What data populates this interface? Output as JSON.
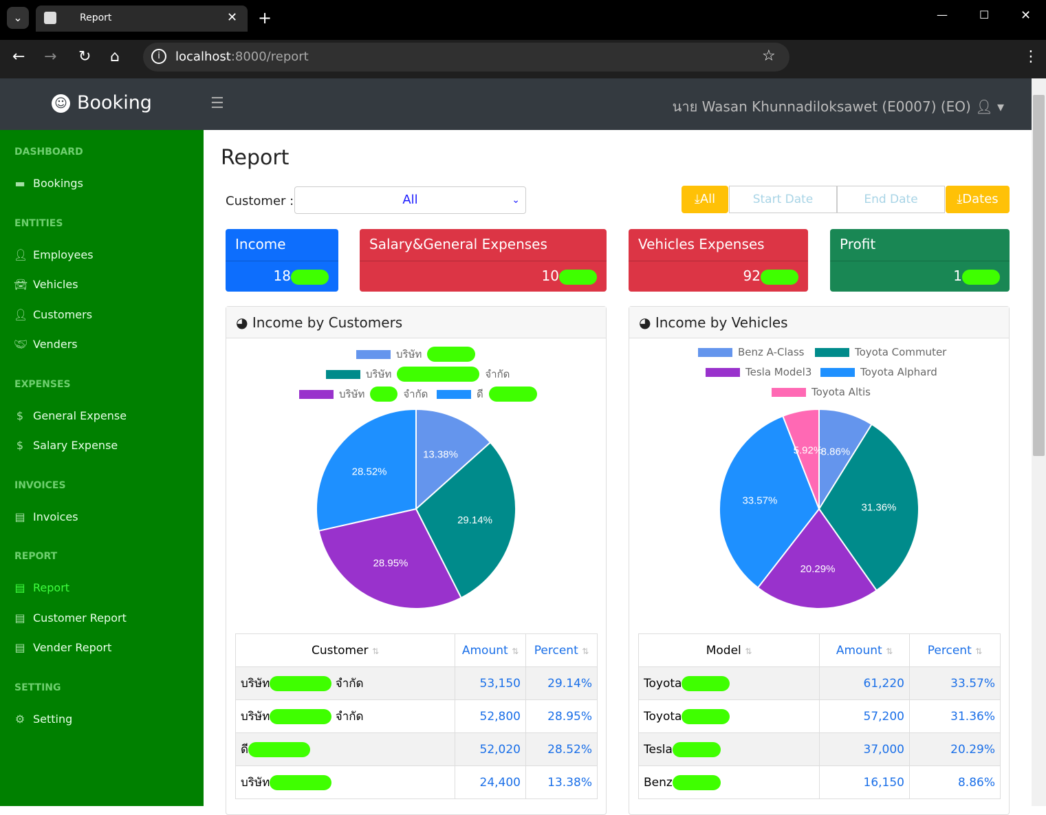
{
  "browser": {
    "tab_title": "Report",
    "url_host": "localhost",
    "url_path": ":8000/report"
  },
  "app": {
    "brand": "Booking",
    "user": "นาย Wasan Khunnadiloksawet (E0007) (EO)"
  },
  "sidebar": {
    "sections": [
      {
        "title": "DASHBOARD",
        "items": [
          {
            "label": "Bookings",
            "icon": "bookings-icon"
          }
        ]
      },
      {
        "title": "ENTITIES",
        "items": [
          {
            "label": "Employees",
            "icon": "user-icon"
          },
          {
            "label": "Vehicles",
            "icon": "car-icon"
          },
          {
            "label": "Customers",
            "icon": "user-icon"
          },
          {
            "label": "Venders",
            "icon": "handshake-icon"
          }
        ]
      },
      {
        "title": "EXPENSES",
        "items": [
          {
            "label": "General Expense",
            "icon": "dollar-icon"
          },
          {
            "label": "Salary Expense",
            "icon": "dollar-icon"
          }
        ]
      },
      {
        "title": "INVOICES",
        "items": [
          {
            "label": "Invoices",
            "icon": "invoice-icon"
          }
        ]
      },
      {
        "title": "REPORT",
        "items": [
          {
            "label": "Report",
            "icon": "file-icon",
            "active": true
          },
          {
            "label": "Customer Report",
            "icon": "file-icon"
          },
          {
            "label": "Vender Report",
            "icon": "file-icon"
          }
        ]
      },
      {
        "title": "SETTING",
        "items": [
          {
            "label": "Setting",
            "icon": "gear-icon"
          }
        ]
      }
    ]
  },
  "main": {
    "title": "Report",
    "customer_label": "Customer :",
    "customer_value": "All",
    "btn_all": "All",
    "start_placeholder": "Start Date",
    "end_placeholder": "End Date",
    "btn_dates": "Dates",
    "cards": [
      {
        "title": "Income",
        "value": "18",
        "color": "#0d6efd"
      },
      {
        "title": "Salary&General Expenses",
        "value": "10",
        "color": "#dc3545"
      },
      {
        "title": "Vehicles Expenses",
        "value": "92",
        "color": "#dc3545"
      },
      {
        "title": "Profit",
        "value": "1",
        "color": "#198754"
      }
    ]
  },
  "chart_data": [
    {
      "type": "pie",
      "title": "Income by Customers",
      "legend": [
        "บริษัท",
        "บริษัท จำกัด",
        "บริษัท จำกัด",
        "ดี"
      ],
      "values": [
        13.38,
        29.14,
        28.95,
        28.52
      ],
      "colors": [
        "#6495ED",
        "#008B8B",
        "#9932CC",
        "#1E90FF"
      ]
    },
    {
      "type": "pie",
      "title": "Income by Vehicles",
      "legend": [
        "Benz A-Class",
        "Toyota Commuter",
        "Tesla Model3",
        "Toyota Alphard",
        "Toyota Altis"
      ],
      "values": [
        8.86,
        31.36,
        20.29,
        33.57,
        5.92
      ],
      "colors": [
        "#6495ED",
        "#008B8B",
        "#9932CC",
        "#1E90FF",
        "#FF69B4"
      ]
    }
  ],
  "tables": [
    {
      "headers": [
        "Customer",
        "Amount",
        "Percent"
      ],
      "rows": [
        [
          "บริษัท",
          "จำกัด",
          "53,150",
          "29.14%"
        ],
        [
          "บริษัท",
          "จำกัด",
          "52,800",
          "28.95%"
        ],
        [
          "ดี",
          "",
          "52,020",
          "28.52%"
        ],
        [
          "บริษัท",
          "",
          "24,400",
          "13.38%"
        ]
      ]
    },
    {
      "headers": [
        "Model",
        "Amount",
        "Percent"
      ],
      "rows": [
        [
          "Toyota",
          "",
          "61,220",
          "33.57%"
        ],
        [
          "Toyota",
          "",
          "57,200",
          "31.36%"
        ],
        [
          "Tesla",
          "",
          "37,000",
          "20.29%"
        ],
        [
          "Benz",
          "",
          "16,150",
          "8.86%"
        ]
      ]
    }
  ]
}
